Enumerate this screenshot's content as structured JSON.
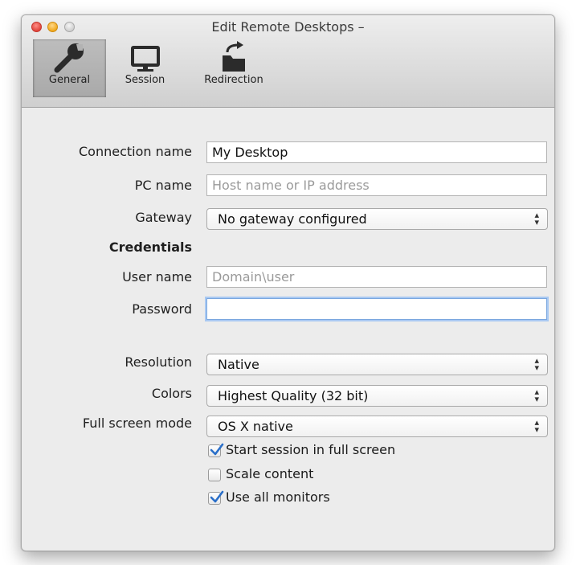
{
  "window": {
    "title": "Edit Remote Desktops –"
  },
  "toolbar": {
    "items": [
      {
        "label": "General",
        "icon": "wrench-icon",
        "selected": true
      },
      {
        "label": "Session",
        "icon": "monitor-icon",
        "selected": false
      },
      {
        "label": "Redirection",
        "icon": "folder-redirect-icon",
        "selected": false
      }
    ]
  },
  "form": {
    "connection_name": {
      "label": "Connection name",
      "value": "My Desktop"
    },
    "pc_name": {
      "label": "PC name",
      "value": "",
      "placeholder": "Host name or IP address"
    },
    "gateway": {
      "label": "Gateway",
      "value": "No gateway configured"
    },
    "credentials_heading": "Credentials",
    "user_name": {
      "label": "User name",
      "value": "",
      "placeholder": "Domain\\user"
    },
    "password": {
      "label": "Password",
      "value": ""
    },
    "resolution": {
      "label": "Resolution",
      "value": "Native"
    },
    "colors": {
      "label": "Colors",
      "value": "Highest Quality (32 bit)"
    },
    "full_screen_mode": {
      "label": "Full screen mode",
      "value": "OS X native"
    },
    "checkboxes": [
      {
        "label": "Start session in full screen",
        "checked": true
      },
      {
        "label": "Scale content",
        "checked": false
      },
      {
        "label": "Use all monitors",
        "checked": true
      }
    ]
  },
  "colors": {
    "check_accent": "#2a6fc9",
    "focus_ring": "#a9c9f2",
    "close_button": "#e0443b",
    "minimize_button": "#f0a81c"
  }
}
